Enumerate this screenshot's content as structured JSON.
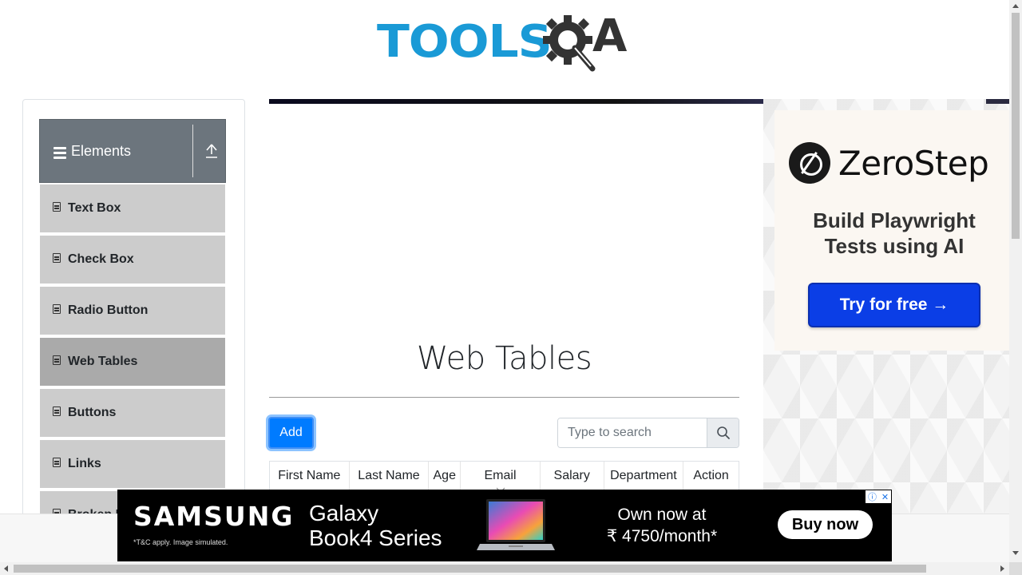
{
  "logo": {
    "tools_text": "TOOLS",
    "qa_text": "A",
    "brand_color": "#1a9ad6"
  },
  "sidebar": {
    "group_title": "Elements",
    "items": [
      {
        "label": "Text Box"
      },
      {
        "label": "Check Box"
      },
      {
        "label": "Radio Button"
      },
      {
        "label": "Web Tables",
        "active": true
      },
      {
        "label": "Buttons"
      },
      {
        "label": "Links"
      },
      {
        "label": "Broken Links - Images"
      }
    ]
  },
  "main": {
    "title": "Web Tables",
    "add_label": "Add",
    "search_placeholder": "Type to search",
    "columns": [
      "First Name",
      "Last Name",
      "Age",
      "Email",
      "Salary",
      "Department",
      "Action"
    ]
  },
  "right_ad": {
    "brand": "ZeroStep",
    "tagline_line1": "Build Playwright",
    "tagline_line2": "Tests using AI",
    "cta": "Try for free →"
  },
  "bottom_ad": {
    "brand": "SAMSUNG",
    "disclaimer": "*T&C apply. Image simulated.",
    "product_line1": "Galaxy",
    "product_line2": "Book4 Series",
    "offer_line1": "Own now at",
    "offer_line2": "₹ 4750/month*",
    "cta": "Buy now"
  },
  "colors": {
    "primary": "#007bff",
    "sidebar_header": "#6c757d",
    "sidebar_item": "#cccccc",
    "sidebar_active": "#aaaaaa",
    "ad_button": "#0b3ee6"
  }
}
